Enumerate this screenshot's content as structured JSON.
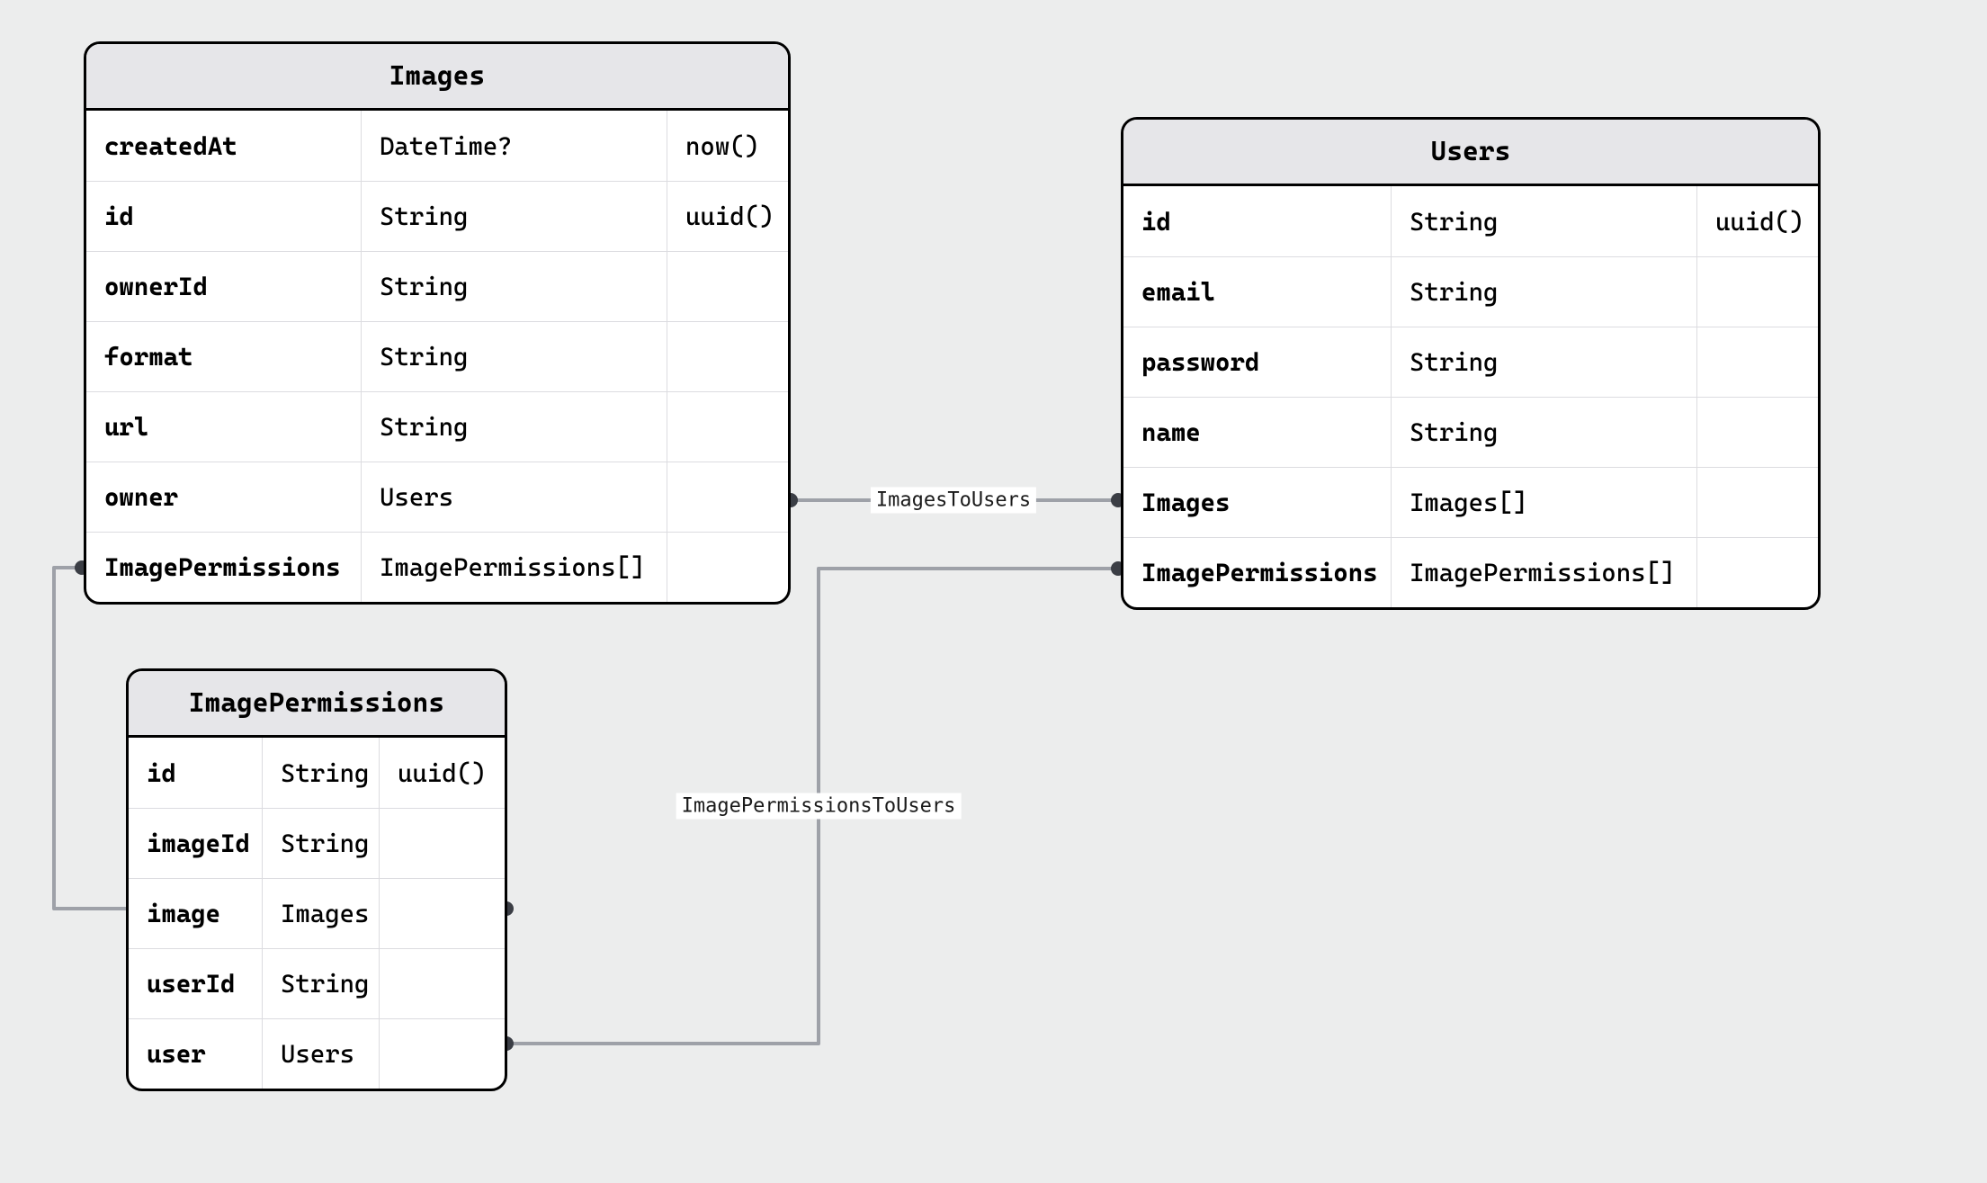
{
  "entities": {
    "images": {
      "title": "Images",
      "fields": [
        {
          "name": "createdAt",
          "type": "DateTime?",
          "default": "now()"
        },
        {
          "name": "id",
          "type": "String",
          "default": "uuid()"
        },
        {
          "name": "ownerId",
          "type": "String",
          "default": ""
        },
        {
          "name": "format",
          "type": "String",
          "default": ""
        },
        {
          "name": "url",
          "type": "String",
          "default": ""
        },
        {
          "name": "owner",
          "type": "Users",
          "default": ""
        },
        {
          "name": "ImagePermissions",
          "type": "ImagePermissions[]",
          "default": ""
        }
      ]
    },
    "users": {
      "title": "Users",
      "fields": [
        {
          "name": "id",
          "type": "String",
          "default": "uuid()"
        },
        {
          "name": "email",
          "type": "String",
          "default": ""
        },
        {
          "name": "password",
          "type": "String",
          "default": ""
        },
        {
          "name": "name",
          "type": "String",
          "default": ""
        },
        {
          "name": "Images",
          "type": "Images[]",
          "default": ""
        },
        {
          "name": "ImagePermissions",
          "type": "ImagePermissions[]",
          "default": ""
        }
      ]
    },
    "imagePermissions": {
      "title": "ImagePermissions",
      "fields": [
        {
          "name": "id",
          "type": "String",
          "default": "uuid()"
        },
        {
          "name": "imageId",
          "type": "String",
          "default": ""
        },
        {
          "name": "image",
          "type": "Images",
          "default": ""
        },
        {
          "name": "userId",
          "type": "String",
          "default": ""
        },
        {
          "name": "user",
          "type": "Users",
          "default": ""
        }
      ]
    }
  },
  "relations": [
    {
      "id": "imagesToUsers",
      "label": "ImagesToUsers"
    },
    {
      "id": "imagePermissionsToUsers",
      "label": "ImagePermissionsToUsers"
    },
    {
      "id": "imagePermissionsToImages",
      "label": ""
    }
  ]
}
